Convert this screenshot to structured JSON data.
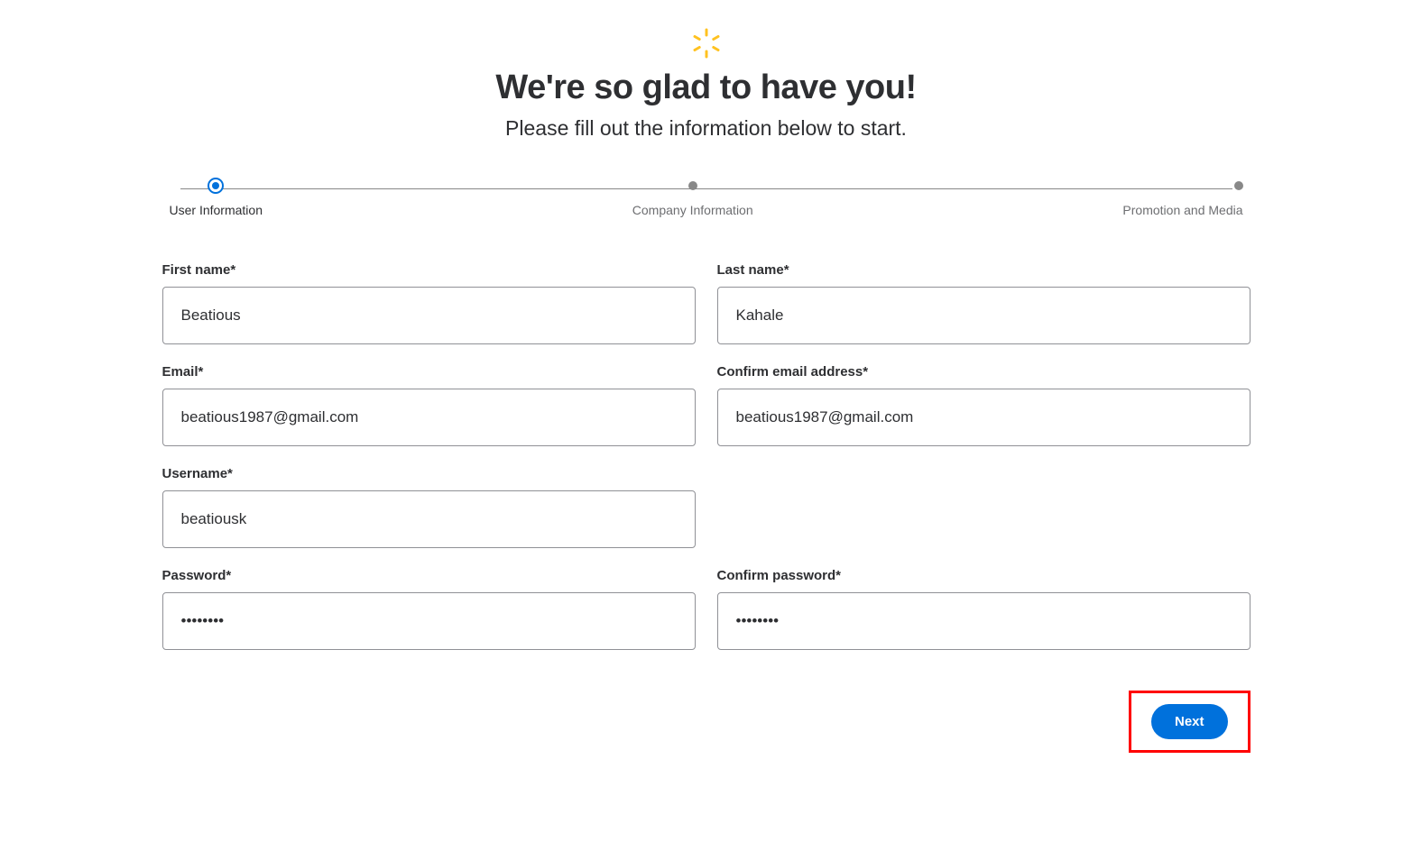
{
  "header": {
    "title": "We're so glad to have you!",
    "subtitle": "Please fill out the information below to start."
  },
  "stepper": {
    "steps": [
      {
        "label": "User Information",
        "active": true
      },
      {
        "label": "Company Information",
        "active": false
      },
      {
        "label": "Promotion and Media",
        "active": false
      }
    ]
  },
  "form": {
    "first_name": {
      "label": "First name*",
      "value": "Beatious"
    },
    "last_name": {
      "label": "Last name*",
      "value": "Kahale"
    },
    "email": {
      "label": "Email*",
      "value": "beatious1987@gmail.com"
    },
    "confirm_email": {
      "label": "Confirm email address*",
      "value": "beatious1987@gmail.com"
    },
    "username": {
      "label": "Username*",
      "value": "beatiousk"
    },
    "password": {
      "label": "Password*",
      "value": "••••••••"
    },
    "confirm_password": {
      "label": "Confirm password*",
      "value": "••••••••"
    }
  },
  "actions": {
    "next_label": "Next"
  }
}
